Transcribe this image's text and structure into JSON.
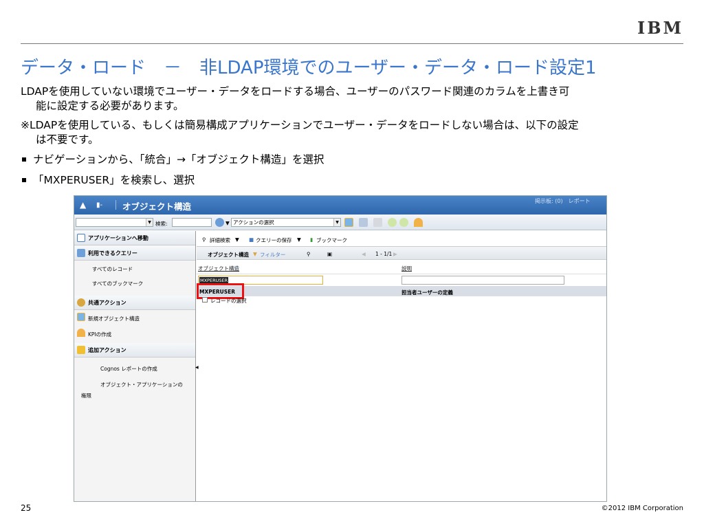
{
  "logo": "IBM",
  "title": "データ・ロード　－　非LDAP環境でのユーザー・データ・ロード設定1",
  "body": {
    "p1_line1": "LDAPを使用していない環境でユーザー・データをロードする場合、ユーザーのパスワード関連のカラムを上書き可",
    "p1_line2": "能に設定する必要があります。",
    "p2_line1": "※LDAPを使用している、もしくは簡易構成アプリケーションでユーザー・データをロードしない場合は、以下の設定",
    "p2_line2": "は不要です。",
    "bullet1": "ナビゲーションから、「統合」→「オブジェクト構造」を選択",
    "bullet2": "「MXPERUSER」を検索し、選択"
  },
  "app": {
    "header_title": "オブジェクト構造",
    "header_right": "掲示板: (0)　レポート",
    "search_label": "検索:",
    "action_select": "アクションの選択",
    "sidebar": {
      "goto_app": "アプリケーションへ移動",
      "available_queries": "利用できるクエリー",
      "all_records": "すべてのレコード",
      "all_bookmarks": "すべてのブックマーク",
      "common_actions": "共通アクション",
      "new_object_structure": "新規オブジェクト構造",
      "create_kpi": "KPIの作成",
      "more_actions": "追加アクション",
      "cognos_report": "Cognos レポートの作成",
      "object_app_perm_1": "オブジェクト・アプリケーションの",
      "object_app_perm_2": "権限"
    },
    "query_bar": {
      "advanced_search": "詳細検索",
      "save_query": "クエリーの保存",
      "bookmarks": "ブックマーク"
    },
    "list": {
      "title": "オブジェクト構造",
      "filter": "フィルター",
      "pager": "1 - 1/1",
      "col_object": "オブジェクト構造",
      "sort_indicator": "÷",
      "col_desc": "説明",
      "filter_value": "MXPERUSER",
      "row_object": "MXPERUSER",
      "row_desc": "担当者ユーザーの定義",
      "select_records": "レコードの選択"
    }
  },
  "footer": {
    "page": "25",
    "copyright": "©2012 IBM Corporation"
  }
}
